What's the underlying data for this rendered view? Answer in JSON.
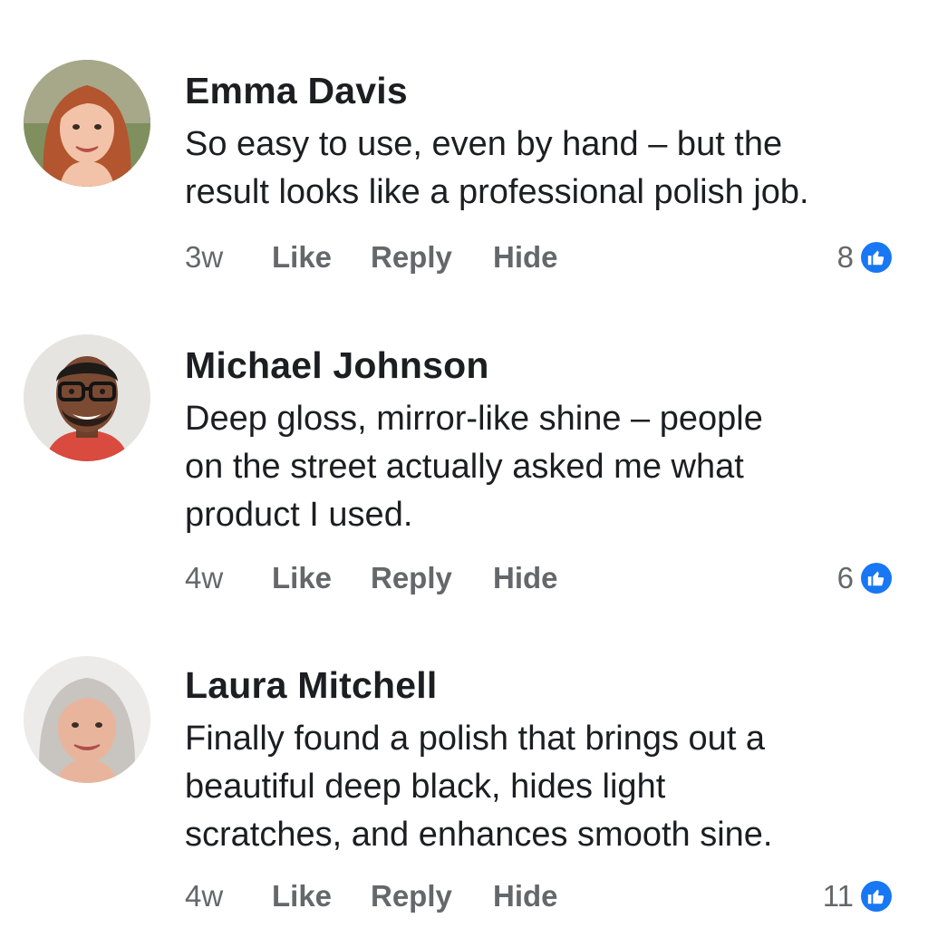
{
  "colors": {
    "text_primary": "#1c1e21",
    "text_secondary": "#65676b",
    "like_blue": "#1877f2",
    "background": "#ffffff"
  },
  "comments": [
    {
      "author": "Emma Davis",
      "avatar_icon": "avatar-woman-red-hair",
      "text_lines": [
        "So easy to use, even by hand – but the",
        "result looks like a professional polish job."
      ],
      "age": "3w",
      "like_label": "Like",
      "reply_label": "Reply",
      "hide_label": "Hide",
      "reaction_count": "8",
      "reaction_icon": "thumbs-up-icon"
    },
    {
      "author": "Michael Johnson",
      "avatar_icon": "avatar-man-glasses",
      "text_lines": [
        "Deep gloss, mirror-like shine – people",
        "on the street actually asked me what",
        "product I used."
      ],
      "age": "4w",
      "like_label": "Like",
      "reply_label": "Reply",
      "hide_label": "Hide",
      "reaction_count": "6",
      "reaction_icon": "thumbs-up-icon"
    },
    {
      "author": "Laura Mitchell",
      "avatar_icon": "avatar-woman-gray-hair",
      "text_lines": [
        "Finally found a  polish that brings out a",
        "beautiful deep black, hides light",
        "scratches, and enhances smooth  sine."
      ],
      "age": "4w",
      "like_label": "Like",
      "reply_label": "Reply",
      "hide_label": "Hide",
      "reaction_count": "11",
      "reaction_icon": "thumbs-up-icon"
    }
  ]
}
